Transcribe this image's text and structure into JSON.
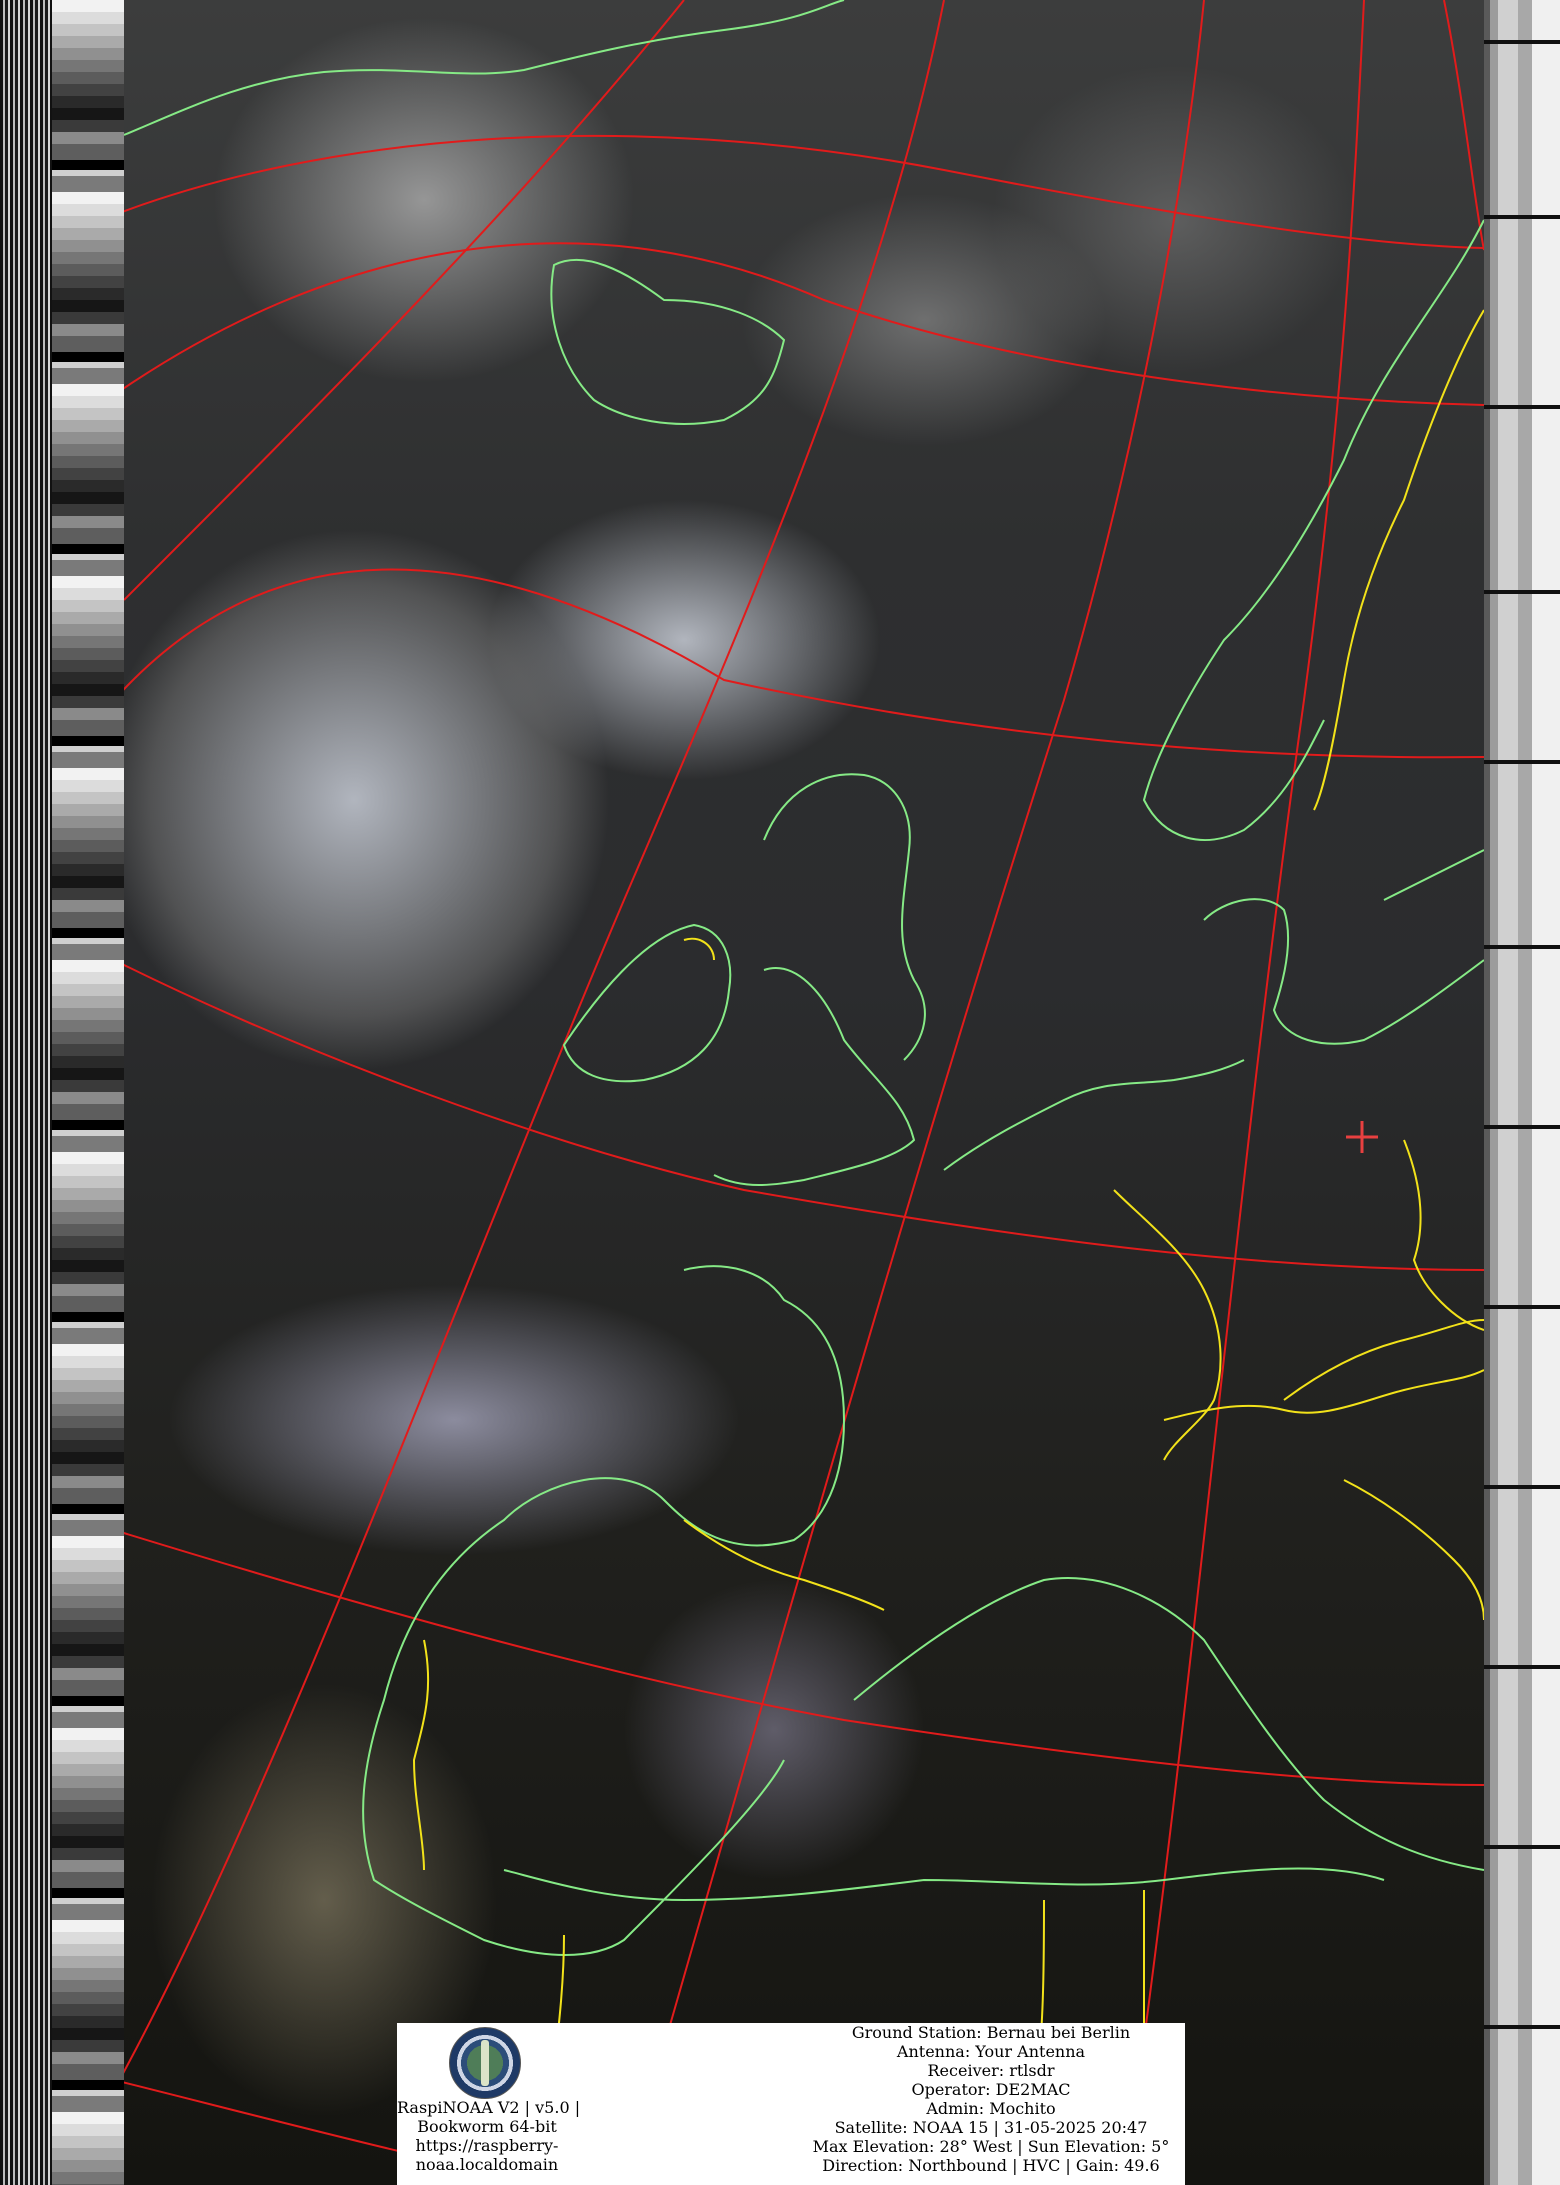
{
  "colors": {
    "graticule": "#e11b1b",
    "coastline": "#86ea86",
    "borders": "#f2e21a",
    "marker": "#e84040"
  },
  "icons": {
    "logo": "raspinoaa-logo-icon",
    "station_marker": "plus-marker-icon"
  },
  "footer": {
    "left_lines": [
      "RaspiNOAA V2 | v5.0 |",
      "Bookworm 64-bit",
      "https://raspberry-",
      "noaa.localdomain"
    ],
    "right_lines": [
      "Ground Station: Bernau bei Berlin",
      "Antenna: Your Antenna",
      "Receiver: rtlsdr",
      "Operator: DE2MAC",
      "Admin: Mochito",
      "Satellite: NOAA 15 | 31-05-2025 20:47",
      "Max Elevation: 28° West | Sun Elevation: 5°",
      "Direction: Northbound | HVC | Gain: 49.6"
    ]
  }
}
